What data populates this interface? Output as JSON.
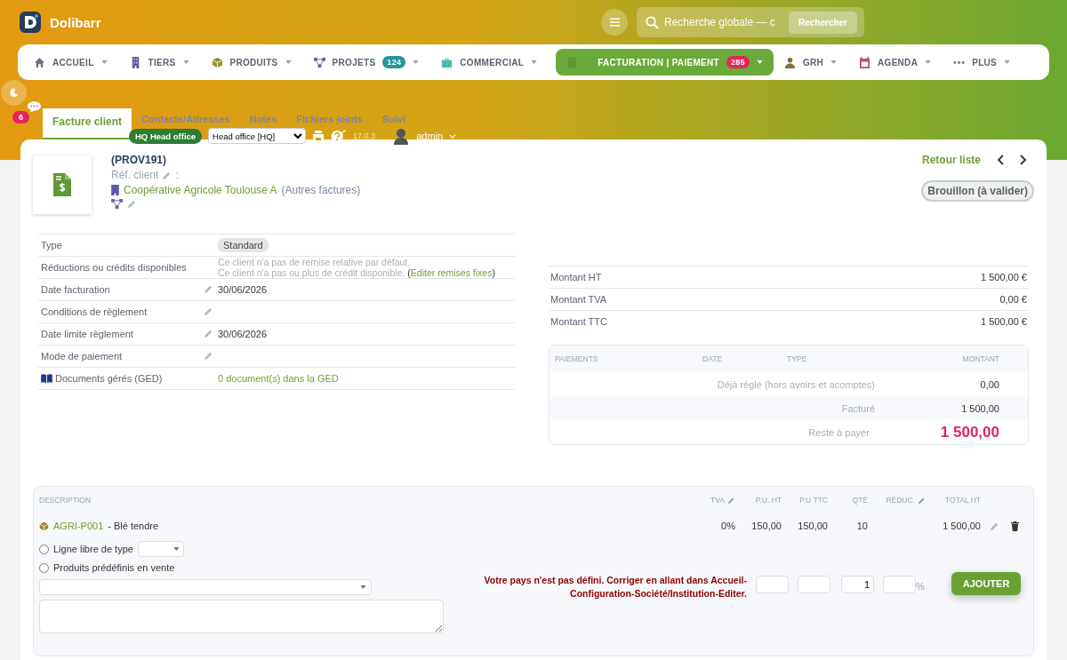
{
  "app": {
    "name": "Dolibarr"
  },
  "search": {
    "placeholder": "Recherche globale — c",
    "button": "Rechercher"
  },
  "menu": [
    {
      "label": "ACCUEIL",
      "kind": "home",
      "selected": false
    },
    {
      "label": "TIERS",
      "kind": "building",
      "selected": false
    },
    {
      "label": "PRODUITS",
      "kind": "box",
      "selected": false
    },
    {
      "label": "PROJETS",
      "kind": "network",
      "badge": "124",
      "color": "#23979a",
      "selected": false
    },
    {
      "label": "COMMERCIAL",
      "kind": "briefcase",
      "selected": false
    },
    {
      "label": "FACTURATION | PAIEMENT",
      "kind": "doc",
      "badge": "285",
      "color": "#e5235f",
      "selected": true
    },
    {
      "label": "GRH",
      "kind": "person",
      "selected": false
    },
    {
      "label": "AGENDA",
      "kind": "calendar",
      "selected": false
    },
    {
      "label": "PLUS",
      "kind": "dots",
      "selected": false
    }
  ],
  "notifications": {
    "count": "6"
  },
  "tabs": [
    {
      "label": "Facture client",
      "selected": true
    },
    {
      "label": "Contacts/Adresses",
      "selected": false
    },
    {
      "label": "Notes",
      "selected": false
    },
    {
      "label": "Fichiers joints",
      "selected": false
    },
    {
      "label": "Suivi",
      "selected": false
    }
  ],
  "toolbar": {
    "entity_badge": "HQ Head office",
    "entity_select": "Head office [HQ]",
    "version": "17.0.3",
    "user": "admin"
  },
  "invoice": {
    "ref": "(PROV191)",
    "ref_client_label": "Réf. client",
    "ref_client_suffix": ":",
    "thirdparty": "Coopérative Agricole Toulouse A",
    "other_invoices": "(Autres factures)",
    "back": "Retour liste",
    "status": "Brouillon (à valider)"
  },
  "fields": [
    {
      "label": "Type",
      "kind": "tag",
      "value": "Standard",
      "editable": false
    },
    {
      "label": "Réductions ou crédits disponibles",
      "kind": "notes",
      "line1": "Ce client n'a pas de remise relative par défaut.",
      "line2": "Ce client n'a pas ou plus de crédit disponible.",
      "before": "(",
      "link": "Editer remises fixes",
      "after": ")",
      "editable": false
    },
    {
      "label": "Date facturation",
      "kind": "text",
      "value": "30/06/2026",
      "editable": true
    },
    {
      "label": "Conditions de règlement",
      "kind": "text",
      "editable": true
    },
    {
      "label": "Date limite règlement",
      "kind": "text",
      "value": "30/06/2026",
      "editable": true
    },
    {
      "label": "Mode de paiement",
      "kind": "text",
      "editable": true
    },
    {
      "label": "Documents gérés (GED)",
      "kind": "link",
      "value": "0 document(s) dans la GED",
      "editable": false
    }
  ],
  "totals": [
    {
      "label": "Montant HT",
      "value": "1 500,00 €"
    },
    {
      "label": "Montant TVA",
      "value": "0,00 €"
    },
    {
      "label": "Montant TTC",
      "value": "1 500,00 €"
    }
  ],
  "payments": {
    "columns": [
      "PAIEMENTS",
      "DATE",
      "TYPE",
      "MONTANT"
    ],
    "rows": [
      {
        "label": "Déjà réglé (hors avoirs et acomptes)",
        "value": "0,00",
        "kind": "normal"
      },
      {
        "label": "Facturé",
        "value": "1 500,00",
        "kind": "normal"
      },
      {
        "label": "Reste à payer",
        "value": "1 500,00",
        "kind": "due"
      }
    ]
  },
  "lines": {
    "columns": [
      {
        "label": "DESCRIPTION",
        "editable": false
      },
      {
        "label": "TVA",
        "editable": true
      },
      {
        "label": "P.U. HT",
        "editable": false
      },
      {
        "label": "P.U TTC",
        "editable": false
      },
      {
        "label": "QTÉ",
        "editable": false
      },
      {
        "label": "RÉDUC.",
        "editable": true
      },
      {
        "label": "TOTAL HT",
        "editable": false
      }
    ],
    "rows": [
      {
        "ref": "AGRI-P001",
        "label": "- Blé tendre",
        "tva": "0%",
        "pu_ht": "150,00",
        "pu_ttc": "150,00",
        "qty": "10",
        "total": "1 500,00"
      }
    ]
  },
  "add_line": {
    "options": [
      {
        "label": "Ligne libre de type",
        "kind": "select",
        "checked": false
      },
      {
        "label": "Produits prédéfinis en vente",
        "kind": "plain",
        "checked": false
      }
    ],
    "warning": "Votre pays n'est pas défini. Corriger en allant dans Accueil-Configuration-Société/Institution-Editer.",
    "qty": "1",
    "percent": "%",
    "button": "AJOUTER"
  }
}
